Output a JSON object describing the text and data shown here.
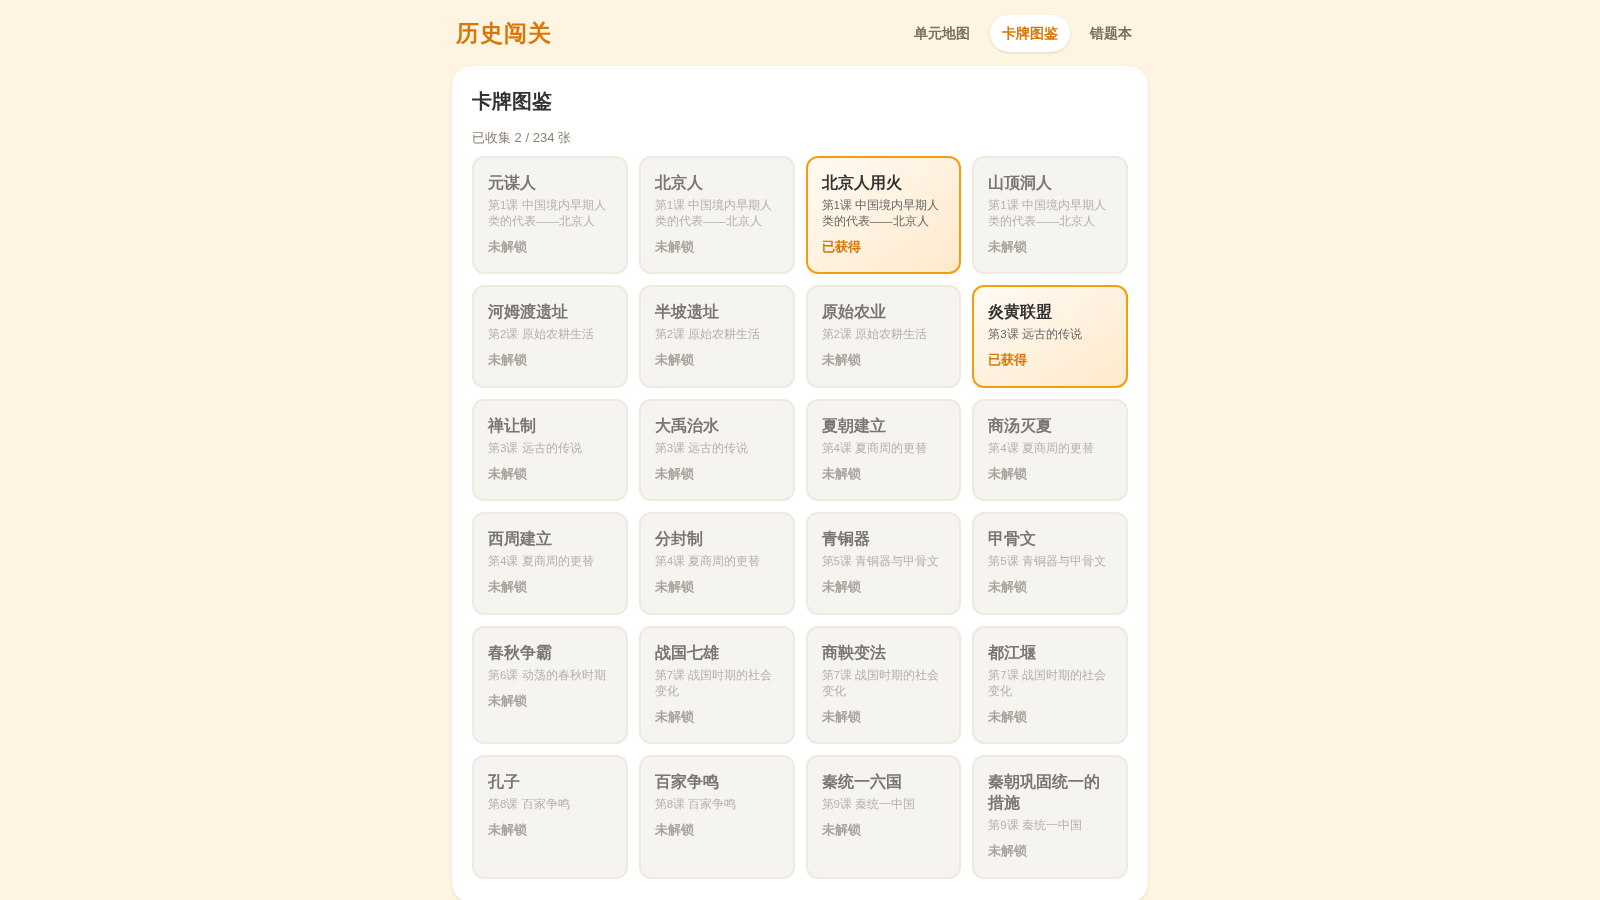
{
  "app": {
    "logo": "历史闯关"
  },
  "nav": [
    {
      "label": "单元地图",
      "selected": false
    },
    {
      "label": "卡牌图鉴",
      "selected": true
    },
    {
      "label": "错题本",
      "selected": false
    }
  ],
  "panel": {
    "title": "卡牌图鉴",
    "summary": "已收集 2 / 234 张"
  },
  "cards": [
    {
      "name": "元谋人",
      "lesson": "第1课 中国境内早期人类的代表——北京人",
      "status": "未解锁",
      "unlocked": false
    },
    {
      "name": "北京人",
      "lesson": "第1课 中国境内早期人类的代表——北京人",
      "status": "未解锁",
      "unlocked": false
    },
    {
      "name": "北京人用火",
      "lesson": "第1课 中国境内早期人类的代表——北京人",
      "status": "已获得",
      "unlocked": true
    },
    {
      "name": "山顶洞人",
      "lesson": "第1课 中国境内早期人类的代表——北京人",
      "status": "未解锁",
      "unlocked": false
    },
    {
      "name": "河姆渡遗址",
      "lesson": "第2课 原始农耕生活",
      "status": "未解锁",
      "unlocked": false
    },
    {
      "name": "半坡遗址",
      "lesson": "第2课 原始农耕生活",
      "status": "未解锁",
      "unlocked": false
    },
    {
      "name": "原始农业",
      "lesson": "第2课 原始农耕生活",
      "status": "未解锁",
      "unlocked": false
    },
    {
      "name": "炎黄联盟",
      "lesson": "第3课 远古的传说",
      "status": "已获得",
      "unlocked": true
    },
    {
      "name": "禅让制",
      "lesson": "第3课 远古的传说",
      "status": "未解锁",
      "unlocked": false
    },
    {
      "name": "大禹治水",
      "lesson": "第3课 远古的传说",
      "status": "未解锁",
      "unlocked": false
    },
    {
      "name": "夏朝建立",
      "lesson": "第4课 夏商周的更替",
      "status": "未解锁",
      "unlocked": false
    },
    {
      "name": "商汤灭夏",
      "lesson": "第4课 夏商周的更替",
      "status": "未解锁",
      "unlocked": false
    },
    {
      "name": "西周建立",
      "lesson": "第4课 夏商周的更替",
      "status": "未解锁",
      "unlocked": false
    },
    {
      "name": "分封制",
      "lesson": "第4课 夏商周的更替",
      "status": "未解锁",
      "unlocked": false
    },
    {
      "name": "青铜器",
      "lesson": "第5课 青铜器与甲骨文",
      "status": "未解锁",
      "unlocked": false
    },
    {
      "name": "甲骨文",
      "lesson": "第5课 青铜器与甲骨文",
      "status": "未解锁",
      "unlocked": false
    },
    {
      "name": "春秋争霸",
      "lesson": "第6课 动荡的春秋时期",
      "status": "未解锁",
      "unlocked": false
    },
    {
      "name": "战国七雄",
      "lesson": "第7课 战国时期的社会变化",
      "status": "未解锁",
      "unlocked": false
    },
    {
      "name": "商鞅变法",
      "lesson": "第7课 战国时期的社会变化",
      "status": "未解锁",
      "unlocked": false
    },
    {
      "name": "都江堰",
      "lesson": "第7课 战国时期的社会变化",
      "status": "未解锁",
      "unlocked": false
    },
    {
      "name": "孔子",
      "lesson": "第8课 百家争鸣",
      "status": "未解锁",
      "unlocked": false
    },
    {
      "name": "百家争鸣",
      "lesson": "第8课 百家争鸣",
      "status": "未解锁",
      "unlocked": false
    },
    {
      "name": "秦统一六国",
      "lesson": "第9课 秦统一中国",
      "status": "未解锁",
      "unlocked": false
    },
    {
      "name": "秦朝巩固统一的措施",
      "lesson": "第9课 秦统一中国",
      "status": "未解锁",
      "unlocked": false
    }
  ]
}
